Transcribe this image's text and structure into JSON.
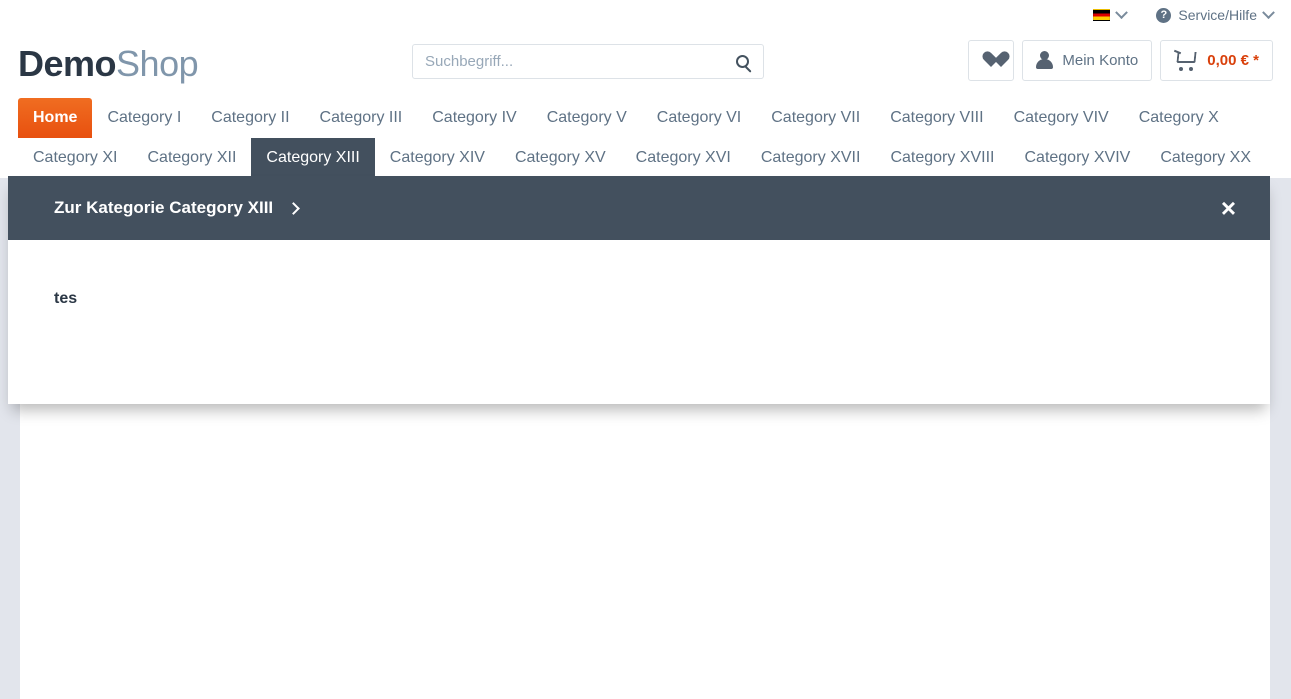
{
  "topbar": {
    "language": {
      "label": "Deutsch",
      "icon": "german-flag-icon",
      "chevron": "chevron-down-icon"
    },
    "service": {
      "label": "Service/Hilfe",
      "icon": "question-mark-icon",
      "chevron": "chevron-down-icon"
    }
  },
  "header": {
    "logo": {
      "part1": "Demo",
      "part2": "Shop"
    },
    "search": {
      "placeholder": "Suchbegriff...",
      "value": "",
      "icon": "search-icon"
    },
    "actions": {
      "wishlist": {
        "label": "",
        "icon": "heart-icon"
      },
      "account": {
        "label": "Mein Konto",
        "icon": "person-icon"
      },
      "cart": {
        "label": "0,00 € *",
        "icon": "cart-icon"
      }
    }
  },
  "nav": {
    "row1": [
      {
        "label": "Home",
        "state": "home"
      },
      {
        "label": "Category I",
        "state": "default"
      },
      {
        "label": "Category II",
        "state": "default"
      },
      {
        "label": "Category III",
        "state": "default"
      },
      {
        "label": "Category IV",
        "state": "default"
      },
      {
        "label": "Category V",
        "state": "default"
      },
      {
        "label": "Category VI",
        "state": "default"
      },
      {
        "label": "Category VII",
        "state": "default"
      },
      {
        "label": "Category VIII",
        "state": "default"
      },
      {
        "label": "Category VIV",
        "state": "default"
      },
      {
        "label": "Category X",
        "state": "default"
      }
    ],
    "row2": [
      {
        "label": "Category XI",
        "state": "default"
      },
      {
        "label": "Category XII",
        "state": "default"
      },
      {
        "label": "Category XIII",
        "state": "active"
      },
      {
        "label": "Category XIV",
        "state": "default"
      },
      {
        "label": "Category XV",
        "state": "default"
      },
      {
        "label": "Category XVI",
        "state": "default"
      },
      {
        "label": "Category XVII",
        "state": "default"
      },
      {
        "label": "Category XVIII",
        "state": "default"
      },
      {
        "label": "Category XVIV",
        "state": "default"
      },
      {
        "label": "Category XX",
        "state": "default"
      }
    ]
  },
  "flyout": {
    "title": "Zur Kategorie Category XIII",
    "chevron": "chevron-right-icon",
    "close": "×",
    "entries": [
      {
        "label": "tes"
      }
    ]
  },
  "colors": {
    "accent_orange": "#d9400b",
    "home_orange": "#e8500f",
    "dark_slate": "#43505e",
    "text_muted": "#5f7285",
    "gutter": "#e2e5ec"
  }
}
